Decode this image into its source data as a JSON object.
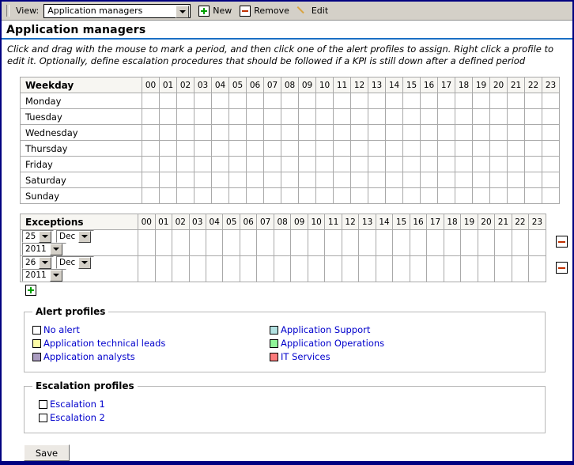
{
  "toolbar": {
    "view_label": "View:",
    "view_value": "Application managers",
    "new_label": "New",
    "remove_label": "Remove",
    "edit_label": "Edit",
    "icons": {
      "new": "plus-box-icon",
      "remove": "minus-box-icon",
      "edit": "pencil-icon",
      "dropdown": "chevron-down-icon"
    }
  },
  "page": {
    "title": "Application managers",
    "instructions": "Click and drag with the mouse to mark a period, and then click one of the alert profiles to assign. Right click a profile to edit it. Optionally, define escalation procedures that should be followed if a KPI is still down after a defined period"
  },
  "hours": [
    "00",
    "01",
    "02",
    "03",
    "04",
    "05",
    "06",
    "07",
    "08",
    "09",
    "10",
    "11",
    "12",
    "13",
    "14",
    "15",
    "16",
    "17",
    "18",
    "19",
    "20",
    "21",
    "22",
    "23"
  ],
  "weekday_table": {
    "corner_header": "Weekday",
    "rows": [
      {
        "name": "Monday",
        "cells": [
          "none",
          "none",
          "none",
          "green",
          "green",
          "green",
          "green",
          "green",
          "yellow",
          "yellow",
          "yellow",
          "yellow",
          "yellow",
          "yellow",
          "yellow",
          "yellow",
          "yellow",
          "yellow",
          "yellow",
          "blue",
          "blue",
          "blue",
          "blue",
          "blue"
        ]
      },
      {
        "name": "Tuesday",
        "cells": [
          "none",
          "none",
          "none",
          "green",
          "green",
          "green",
          "green",
          "green",
          "yellow",
          "yellow",
          "yellow",
          "yellow",
          "yellow",
          "yellow",
          "yellow",
          "yellow",
          "yellow",
          "yellow",
          "yellow",
          "blue",
          "blue",
          "blue",
          "blue",
          "blue"
        ]
      },
      {
        "name": "Wednesday",
        "cells": [
          "none",
          "none",
          "none",
          "green",
          "green",
          "green",
          "green",
          "green",
          "yellow",
          "yellow",
          "yellow",
          "yellow",
          "yellow",
          "yellow",
          "yellow",
          "yellow",
          "yellow",
          "yellow",
          "yellow",
          "blue",
          "blue",
          "blue",
          "blue",
          "blue"
        ]
      },
      {
        "name": "Thursday",
        "cells": [
          "none",
          "none",
          "none",
          "green",
          "green",
          "green",
          "green",
          "green",
          "yellow",
          "yellow",
          "yellow",
          "yellow",
          "yellow",
          "yellow",
          "yellow",
          "yellow",
          "yellow",
          "yellow",
          "yellow",
          "blue",
          "blue",
          "blue",
          "blue",
          "blue"
        ]
      },
      {
        "name": "Friday",
        "cells": [
          "none",
          "none",
          "none",
          "green",
          "green",
          "green",
          "green",
          "green",
          "yellow",
          "yellow",
          "yellow",
          "yellow",
          "yellow",
          "yellow",
          "yellow",
          "yellow",
          "yellow",
          "yellow",
          "yellow",
          "blue",
          "blue",
          "blue",
          "blue",
          "blue"
        ]
      },
      {
        "name": "Saturday",
        "cells": [
          "none",
          "none",
          "none",
          "green",
          "green",
          "green",
          "green",
          "green",
          "red",
          "red",
          "red",
          "red",
          "red",
          "red",
          "red",
          "red",
          "red",
          "red",
          "red",
          "blue",
          "blue",
          "blue",
          "blue",
          "blue"
        ]
      },
      {
        "name": "Sunday",
        "cells": [
          "none",
          "none",
          "none",
          "green",
          "green",
          "green",
          "green",
          "green",
          "red",
          "red",
          "red",
          "red",
          "red",
          "red",
          "red",
          "red",
          "red",
          "red",
          "red",
          "blue",
          "blue",
          "blue",
          "blue",
          "blue"
        ]
      }
    ]
  },
  "exceptions_table": {
    "corner_header": "Exceptions",
    "rows": [
      {
        "day": "25",
        "month": "Dec",
        "year": "2011",
        "remove_icon": "minus-box-icon",
        "cells": [
          "none",
          "none",
          "none",
          "none",
          "none",
          "none",
          "none",
          "none",
          "red",
          "red",
          "red",
          "red",
          "red",
          "red",
          "red",
          "red",
          "red",
          "red",
          "red",
          "none",
          "none",
          "none",
          "none",
          "none"
        ]
      },
      {
        "day": "26",
        "month": "Dec",
        "year": "2011",
        "remove_icon": "minus-box-icon",
        "cells": [
          "none",
          "none",
          "none",
          "none",
          "none",
          "none",
          "none",
          "red",
          "red",
          "red",
          "red",
          "red",
          "red",
          "red",
          "red",
          "red",
          "red",
          "red",
          "red",
          "red",
          "none",
          "none",
          "none",
          "none"
        ]
      }
    ],
    "add_icon": "plus-box-icon"
  },
  "alert_profiles": {
    "legend": "Alert profiles",
    "left": [
      {
        "label": "No alert",
        "color": "#ffffff"
      },
      {
        "label": "Application technical leads",
        "color": "#fdfca6"
      },
      {
        "label": "Application analysts",
        "color": "#aa9cc0"
      }
    ],
    "right": [
      {
        "label": "Application Support",
        "color": "#b2e1e1"
      },
      {
        "label": "Application Operations",
        "color": "#90f598"
      },
      {
        "label": "IT Services",
        "color": "#fc7b7b"
      }
    ]
  },
  "escalation_profiles": {
    "legend": "Escalation profiles",
    "items": [
      {
        "label": "Escalation 1",
        "color": "#ffffff"
      },
      {
        "label": "Escalation 2",
        "color": "#ffffff"
      }
    ]
  },
  "actions": {
    "save_label": "Save"
  },
  "colors": {
    "green": "#90f598",
    "yellow": "#fdfca6",
    "blue": "#b2e1e1",
    "red": "#fc7b7b",
    "none": "#ffffff",
    "accent": "#1a6fc4",
    "window_border": "#000080",
    "link": "#0000cc"
  }
}
